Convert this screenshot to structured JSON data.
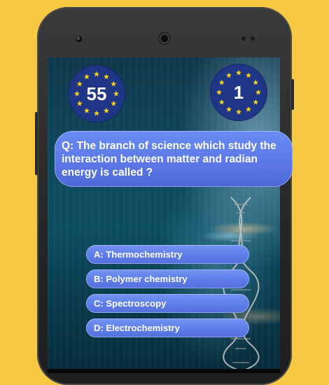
{
  "score": {
    "value": "55"
  },
  "level": {
    "value": "1"
  },
  "question": {
    "text": "Q: The branch of science which study the interaction between matter and radian energy is called ?"
  },
  "options": [
    {
      "label": "A: Thermochemistry"
    },
    {
      "label": "B: Polymer chemistry"
    },
    {
      "label": "C: Spectroscopy"
    },
    {
      "label": "D: Electrochemistry"
    }
  ],
  "colors": {
    "page_background": "#f7c844",
    "badge": "#1f3687",
    "badge_star": "#f7d21a",
    "question_bubble": "#5b79e6",
    "option_button": "#5d7be6",
    "text": "#ffffff"
  },
  "icons": [
    "star-icon",
    "dna-helix-icon"
  ]
}
